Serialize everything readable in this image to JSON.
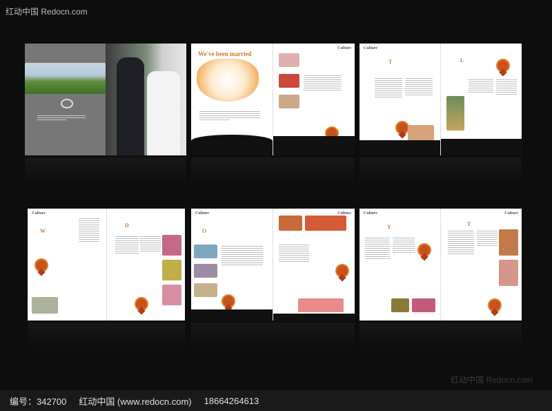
{
  "watermark_top": "红动中国 Redocn.com",
  "watermark_bottom": "红动中国 Redocn.com",
  "footer": {
    "id_text": "编号：342700",
    "site_text": "红动中国 (www.redocn.com)",
    "phone_text": "18664264613"
  },
  "brochure": {
    "spread2_title": "We've been married",
    "culture_label": "Culture"
  },
  "colors": {
    "accent": "#d0752a",
    "ribbon": "#c8521e",
    "background": "#0d0d0d"
  }
}
